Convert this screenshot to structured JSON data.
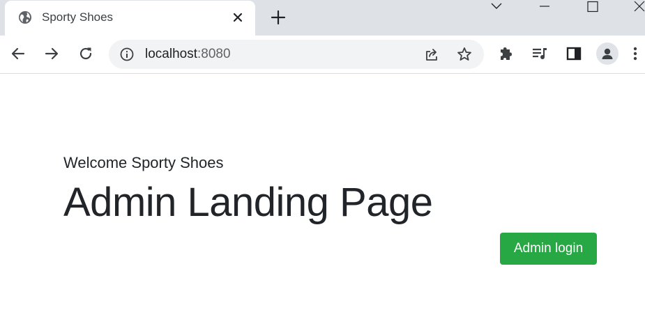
{
  "browser": {
    "tab": {
      "title": "Sporty Shoes",
      "favicon": "globe-icon",
      "close_icon": "close-icon"
    },
    "new_tab_icon": "plus-icon",
    "window_controls": [
      "chevron-down-icon",
      "minimize-icon",
      "maximize-icon",
      "close-icon"
    ],
    "nav": [
      "back-arrow-icon",
      "forward-arrow-icon",
      "reload-icon"
    ],
    "address_bar": {
      "host": "localhost",
      "port": ":8080",
      "info_icon": "info-icon"
    },
    "address_actions": [
      "share-icon",
      "star-icon"
    ],
    "extensions": [
      "puzzle-icon",
      "media-queue-icon",
      "side-panel-icon"
    ],
    "profile_icon": "person-icon",
    "menu_icon": "more-vertical-icon"
  },
  "page": {
    "welcome": "Welcome Sporty Shoes",
    "heading": "Admin Landing Page",
    "admin_login_label": "Admin login"
  },
  "colors": {
    "tabstrip_bg": "#dee1e6",
    "omnibox_bg": "#f1f3f4",
    "text": "#212529",
    "button_green": "#28a745"
  }
}
